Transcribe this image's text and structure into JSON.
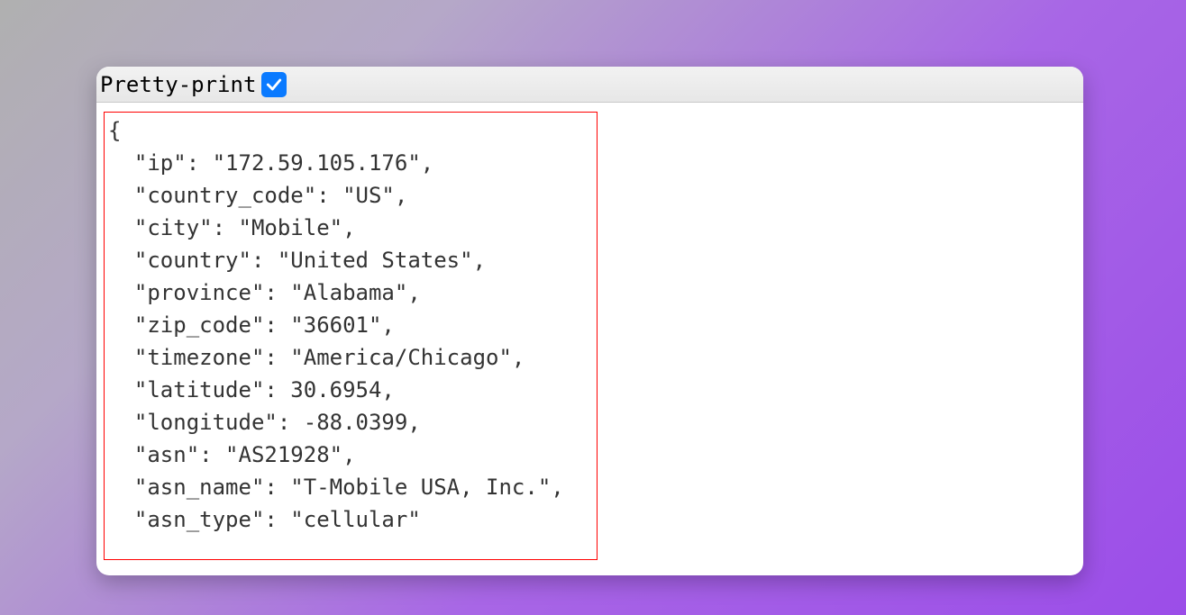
{
  "toolbar": {
    "label": "Pretty-print",
    "checked": true
  },
  "json": {
    "open_brace": "{",
    "entries": [
      {
        "key": "ip",
        "value": "\"172.59.105.176\"",
        "trailing_comma": true
      },
      {
        "key": "country_code",
        "value": "\"US\"",
        "trailing_comma": true
      },
      {
        "key": "city",
        "value": "\"Mobile\"",
        "trailing_comma": true
      },
      {
        "key": "country",
        "value": "\"United States\"",
        "trailing_comma": true
      },
      {
        "key": "province",
        "value": "\"Alabama\"",
        "trailing_comma": true
      },
      {
        "key": "zip_code",
        "value": "\"36601\"",
        "trailing_comma": true
      },
      {
        "key": "timezone",
        "value": "\"America/Chicago\"",
        "trailing_comma": true
      },
      {
        "key": "latitude",
        "value": "30.6954",
        "trailing_comma": true
      },
      {
        "key": "longitude",
        "value": "-88.0399",
        "trailing_comma": true
      },
      {
        "key": "asn",
        "value": "\"AS21928\"",
        "trailing_comma": true
      },
      {
        "key": "asn_name",
        "value": "\"T-Mobile USA, Inc.\"",
        "trailing_comma": true
      },
      {
        "key": "asn_type",
        "value": "\"cellular\"",
        "trailing_comma": false
      }
    ]
  }
}
